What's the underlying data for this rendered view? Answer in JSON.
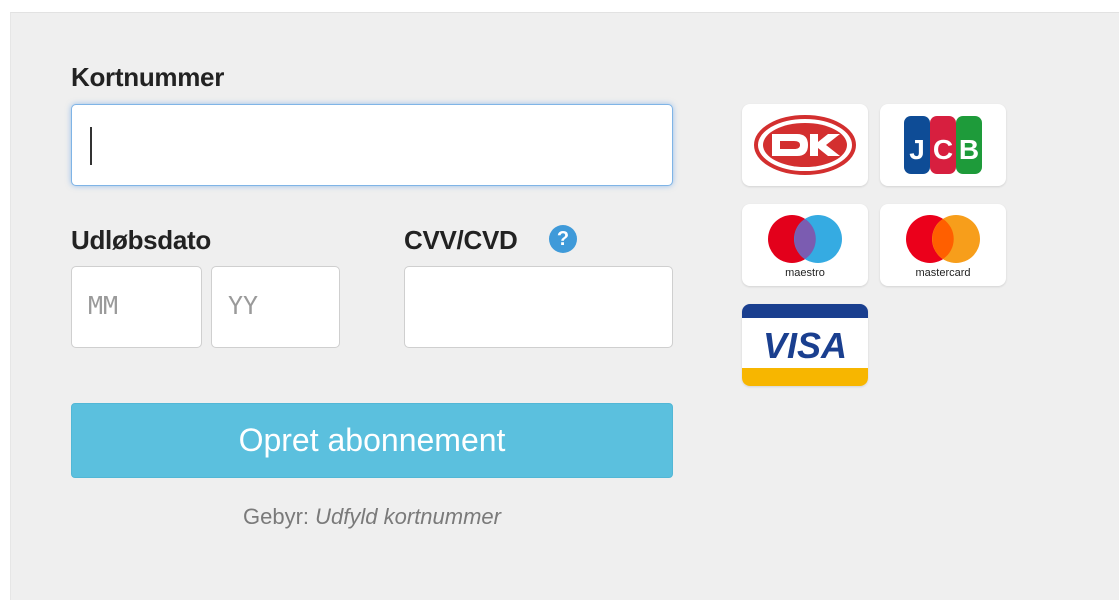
{
  "form": {
    "card_number_label": "Kortnummer",
    "card_number_value": "",
    "expiry_label": "Udløbsdato",
    "month_placeholder": "MM",
    "year_placeholder": "YY",
    "cvv_label": "CVV/CVD",
    "cvv_help_icon": "question-circle-icon",
    "submit_label": "Opret abonnement",
    "fee_label": "Gebyr:",
    "fee_value": "Udfyld kortnummer"
  },
  "card_logos": {
    "maestro_text": "maestro",
    "mastercard_text": "mastercard",
    "visa_text": "VISA",
    "jcb_text": "JCB"
  },
  "colors": {
    "button": "#5bc0de",
    "help_icon": "#3f9ad9"
  }
}
